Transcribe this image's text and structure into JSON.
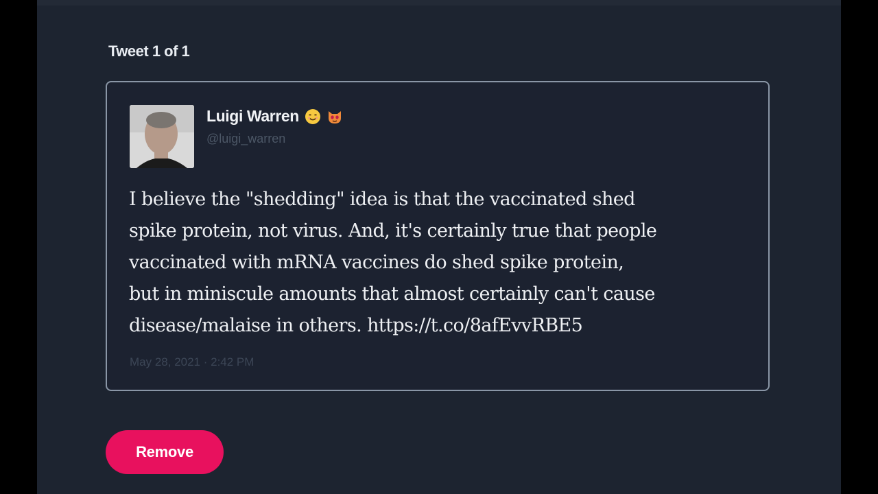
{
  "heading": "Tweet 1 of 1",
  "tweet": {
    "author_name": "Luigi Warren",
    "author_emojis": [
      "smiling-face-icon",
      "cat-face-icon"
    ],
    "handle": "@luigi_warren",
    "text": "I believe the \"shedding\" idea is that the vaccinated shed\nspike protein, not virus. And, it's certainly true that people\nvaccinated with mRNA vaccines do shed spike protein,\nbut in miniscule amounts that almost certainly can't cause\ndisease/malaise in others. https://t.co/8afEvvRBE5",
    "timestamp": "May 28, 2021 · 2:42 PM"
  },
  "actions": {
    "remove_label": "Remove"
  },
  "colors": {
    "background": "#1d2430",
    "card_border": "#8a96a6",
    "remove_button": "#e8115e",
    "text_primary": "#eef0f3",
    "text_muted": "#4c5766"
  }
}
